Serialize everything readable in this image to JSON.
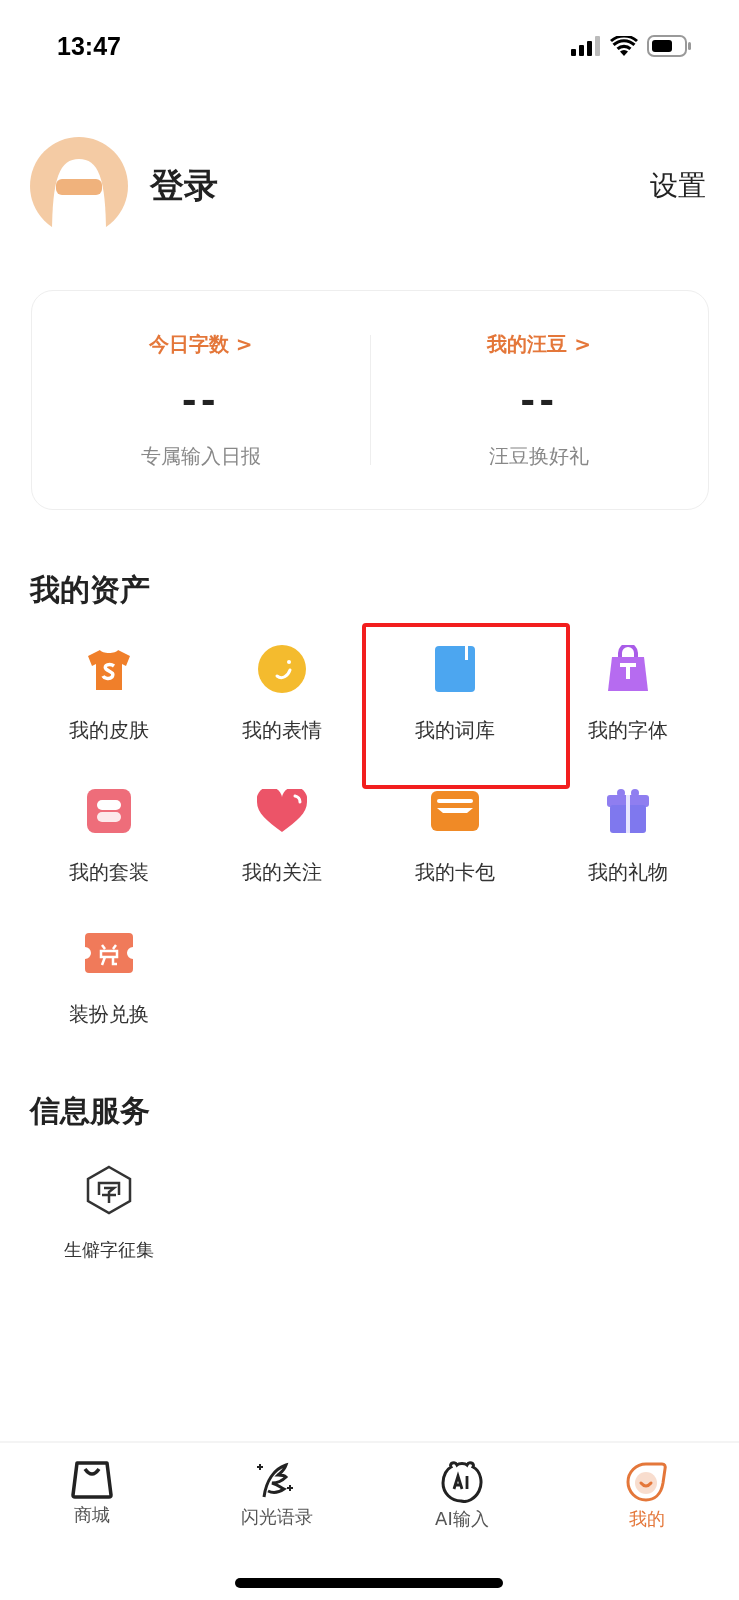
{
  "status_bar": {
    "time": "13:47"
  },
  "profile": {
    "login": "登录",
    "settings": "设置"
  },
  "stats": [
    {
      "title": "今日字数",
      "arrow": ">",
      "value": "--",
      "caption": "专属输入日报"
    },
    {
      "title": "我的汪豆",
      "arrow": ">",
      "value": "--",
      "caption": "汪豆换好礼"
    }
  ],
  "assets": {
    "title": "我的资产",
    "items": [
      {
        "label": "我的皮肤",
        "highlighted": false
      },
      {
        "label": "我的表情",
        "highlighted": false
      },
      {
        "label": "我的词库",
        "highlighted": true
      },
      {
        "label": "我的字体",
        "highlighted": false
      },
      {
        "label": "我的套装",
        "highlighted": false
      },
      {
        "label": "我的关注",
        "highlighted": false
      },
      {
        "label": "我的卡包",
        "highlighted": false
      },
      {
        "label": "我的礼物",
        "highlighted": false
      },
      {
        "label": "装扮兑换",
        "highlighted": false
      }
    ]
  },
  "services": {
    "title": "信息服务",
    "items": [
      {
        "label": "生僻字征集"
      }
    ]
  },
  "tabs": [
    {
      "label": "商城",
      "selected": false
    },
    {
      "label": "闪光语录",
      "selected": false
    },
    {
      "label": "AI输入",
      "selected": false
    },
    {
      "label": "我的",
      "selected": true
    }
  ]
}
